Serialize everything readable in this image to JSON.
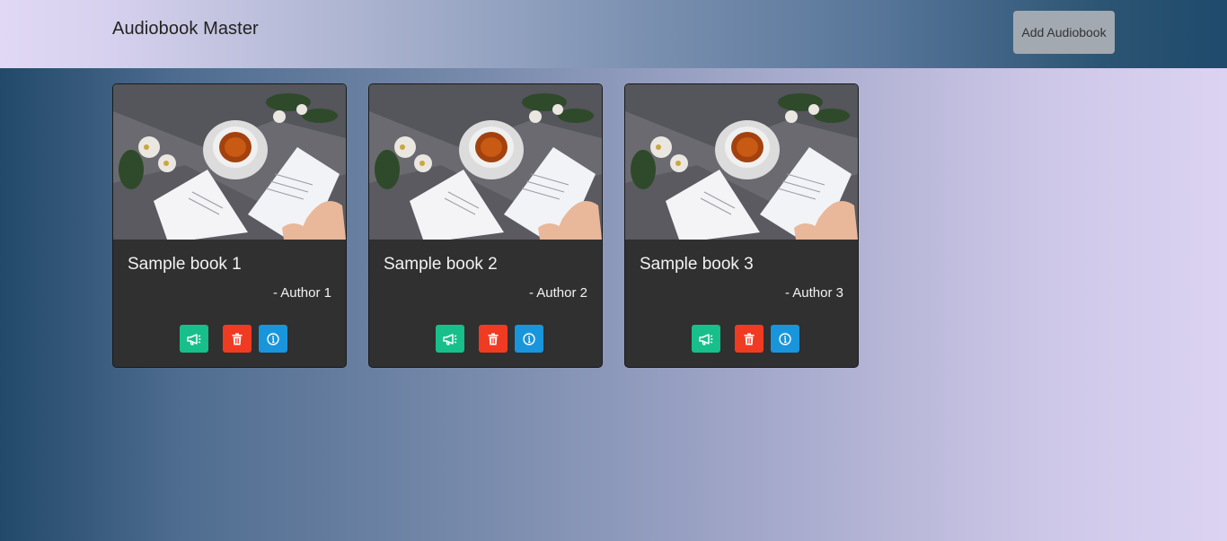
{
  "header": {
    "title": "Audiobook Master",
    "add_button_label": "Add Audiobook"
  },
  "books": [
    {
      "title": "Sample book 1",
      "author": "- Author 1"
    },
    {
      "title": "Sample book 2",
      "author": "- Author 2"
    },
    {
      "title": "Sample book 3",
      "author": "- Author 3"
    }
  ],
  "actions": {
    "play_icon": "megaphone-icon",
    "delete_icon": "trash-icon",
    "info_icon": "info-icon"
  },
  "colors": {
    "play": "#17bf8a",
    "delete": "#f03b22",
    "info": "#1996db",
    "card_bg": "#303030"
  }
}
